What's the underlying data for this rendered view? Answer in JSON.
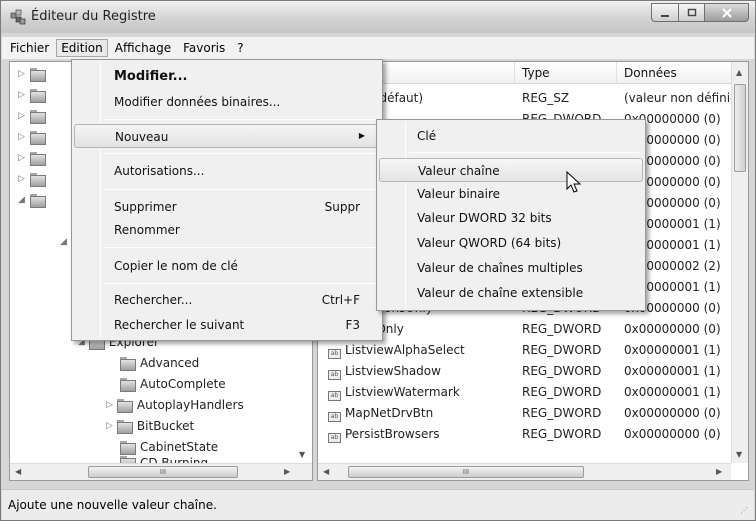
{
  "window": {
    "title": "Éditeur du Registre",
    "controls": [
      "minimize-icon",
      "maximize-icon",
      "close-icon"
    ]
  },
  "menubar": [
    "Fichier",
    "Edition",
    "Affichage",
    "Favoris",
    "?"
  ],
  "edit_menu": {
    "items": [
      {
        "label": "Modifier...",
        "shortcut": ""
      },
      {
        "label": "Modifier données binaires...",
        "shortcut": ""
      },
      {
        "label": "Nouveau",
        "shortcut": ""
      },
      {
        "label": "Autorisations...",
        "shortcut": ""
      },
      {
        "label": "Supprimer",
        "shortcut": "Suppr"
      },
      {
        "label": "Renommer",
        "shortcut": ""
      },
      {
        "label": "Copier le nom de clé",
        "shortcut": ""
      },
      {
        "label": "Rechercher...",
        "shortcut": "Ctrl+F"
      },
      {
        "label": "Rechercher le suivant",
        "shortcut": "F3"
      }
    ]
  },
  "new_submenu": {
    "items": [
      "Clé",
      "Valeur chaîne",
      "Valeur binaire",
      "Valeur DWORD 32 bits",
      "Valeur QWORD (64 bits)",
      "Valeur de chaînes multiples",
      "Valeur de chaîne extensible"
    ]
  },
  "tree": {
    "items": [
      "Explorer",
      "Advanced",
      "AutoComplete",
      "AutoplayHandlers",
      "BitBucket",
      "CabinetState",
      "CD Burning"
    ]
  },
  "list": {
    "headers": {
      "name": "",
      "type": "Type",
      "data": "Données"
    },
    "rows": [
      {
        "name": "(Par défaut)",
        "type": "REG_SZ",
        "data": "(valeur non définie)"
      },
      {
        "name": "",
        "type": "REG_DWORD",
        "data": "0x00000000 (0)"
      },
      {
        "name": "",
        "type": "",
        "data": "0x00000000 (0)"
      },
      {
        "name": "",
        "type": "",
        "data": "0x00000000 (0)"
      },
      {
        "name": "",
        "type": "",
        "data": "0x00000000 (0)"
      },
      {
        "name": "",
        "type": "",
        "data": "0x00000000 (0)"
      },
      {
        "name": "",
        "type": "",
        "data": "0x00000001 (1)"
      },
      {
        "name": "",
        "type": "",
        "data": "0x00000001 (1)"
      },
      {
        "name": "",
        "type": "",
        "data": "0x00000002 (2)"
      },
      {
        "name": "",
        "type": "",
        "data": "0x00000001 (1)"
      },
      {
        "name": "IconsOnly",
        "type": "REG_DWORD",
        "data": "0x00000000 (0)"
      },
      {
        "name": "IconsOnly",
        "type": "REG_DWORD",
        "data": "0x00000000 (0)"
      },
      {
        "name": "ListviewAlphaSelect",
        "type": "REG_DWORD",
        "data": "0x00000001 (1)"
      },
      {
        "name": "ListviewShadow",
        "type": "REG_DWORD",
        "data": "0x00000001 (1)"
      },
      {
        "name": "ListviewWatermark",
        "type": "REG_DWORD",
        "data": "0x00000001 (1)"
      },
      {
        "name": "MapNetDrvBtn",
        "type": "REG_DWORD",
        "data": "0x00000000 (0)"
      },
      {
        "name": "PersistBrowsers",
        "type": "REG_DWORD",
        "data": "0x00000000 (0)"
      }
    ]
  },
  "hscroll_label": "III",
  "status": "Ajoute une nouvelle valeur chaîne."
}
